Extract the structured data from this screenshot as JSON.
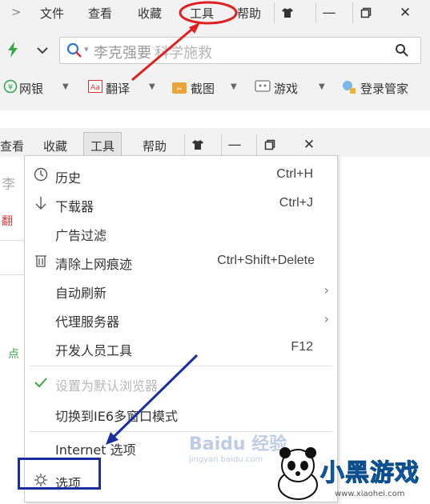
{
  "top": {
    "menubar": {
      "chevron": ">",
      "items": [
        "文件",
        "查看",
        "收藏",
        "工具",
        "帮助"
      ]
    },
    "window_controls": [
      "shirt-icon",
      "minimize-icon",
      "maximize-icon",
      "close-icon"
    ],
    "close_glyph": "✕",
    "minimize_glyph": "—",
    "maximize_glyph": "❐",
    "shirt_glyph": "👕",
    "search": {
      "query": "李克强要",
      "query_obscured": "科学施救"
    },
    "favorites": [
      {
        "label": "网银",
        "icon": "bank-icon"
      },
      {
        "label": "翻译",
        "icon": "translate-icon"
      },
      {
        "label": "截图",
        "icon": "screenshot-icon"
      },
      {
        "label": "游戏",
        "icon": "game-icon"
      },
      {
        "label": "登录管家",
        "icon": "login-manager-icon"
      }
    ]
  },
  "bottom": {
    "menubar": {
      "items": [
        "查看",
        "收藏",
        "工具",
        "帮助"
      ],
      "active": "工具"
    },
    "bg_partial": [
      "李",
      "翻",
      "点"
    ],
    "tools_menu": {
      "items": [
        {
          "label": "历史",
          "shortcut": "Ctrl+H",
          "icon": "clock-icon"
        },
        {
          "label": "下载器",
          "shortcut": "Ctrl+J",
          "icon": "download-icon"
        },
        {
          "label": "广告过滤",
          "shortcut": ""
        },
        {
          "label": "清除上网痕迹",
          "shortcut": "Ctrl+Shift+Delete",
          "icon": "trash-icon"
        },
        {
          "label": "自动刷新",
          "submenu": true
        },
        {
          "label": "代理服务器",
          "submenu": true
        },
        {
          "label": "开发人员工具",
          "shortcut": "F12"
        },
        {
          "label": "设置为默认浏览器",
          "disabled": true,
          "icon": "check-icon"
        },
        {
          "label": "切换到IE6多窗口模式"
        },
        {
          "label": "Internet 选项"
        },
        {
          "label": "选项",
          "icon": "gear-icon",
          "highlighted": true
        }
      ]
    },
    "watermark_text": "Baidu 经验",
    "watermark_url": "jingyan.baidu.com",
    "logo": {
      "text": "小黑游戏",
      "url": "www.xiaohei.com"
    }
  },
  "colors": {
    "annotation_red": "#e02020",
    "annotation_blue": "#1a2ea0",
    "check_green": "#3aa845",
    "lightning_green": "#35a845",
    "search_icon_blue": "#2b79d6"
  }
}
